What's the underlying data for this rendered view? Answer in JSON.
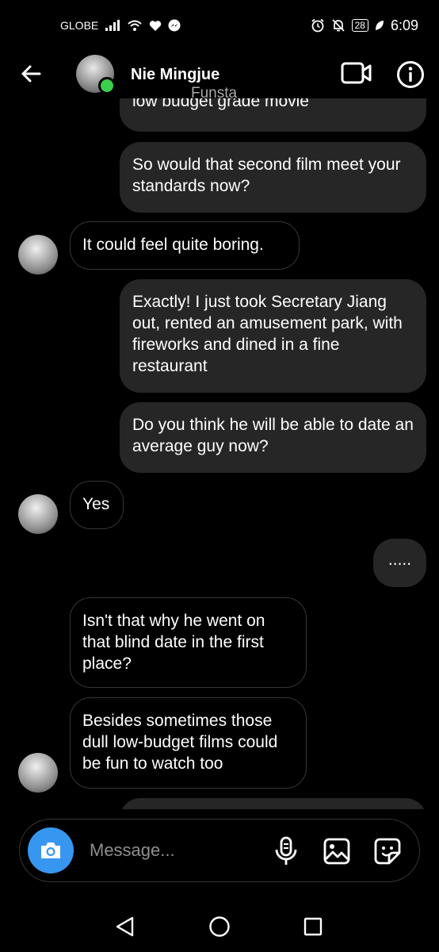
{
  "status_bar": {
    "carrier": "GLOBE",
    "battery": "28",
    "time": "6:09"
  },
  "header": {
    "name": "Nie Mingjue",
    "subtitle": "Funsta"
  },
  "messages": [
    {
      "dir": "out",
      "text": "low budget grade movie"
    },
    {
      "dir": "out",
      "text": "So would that second film meet your standards now?"
    },
    {
      "dir": "in",
      "text": "It could feel quite boring."
    },
    {
      "dir": "out",
      "text": "Exactly! I just took Secretary Jiang out, rented an amusement park, with fireworks and dined in a fine restaurant"
    },
    {
      "dir": "out",
      "text": "Do you think he will be able to date an average guy now?"
    },
    {
      "dir": "in",
      "text": "Yes"
    },
    {
      "dir": "out",
      "text": "....."
    },
    {
      "dir": "in",
      "text": "Isn't that why he went on that blind date in the first place?"
    },
    {
      "dir": "in",
      "text": "Besides sometimes those dull low-budget films could be fun to watch too"
    }
  ],
  "composer": {
    "placeholder": "Message..."
  },
  "icons": {
    "accent": "#3797f0",
    "online": "#3ccf4e"
  }
}
